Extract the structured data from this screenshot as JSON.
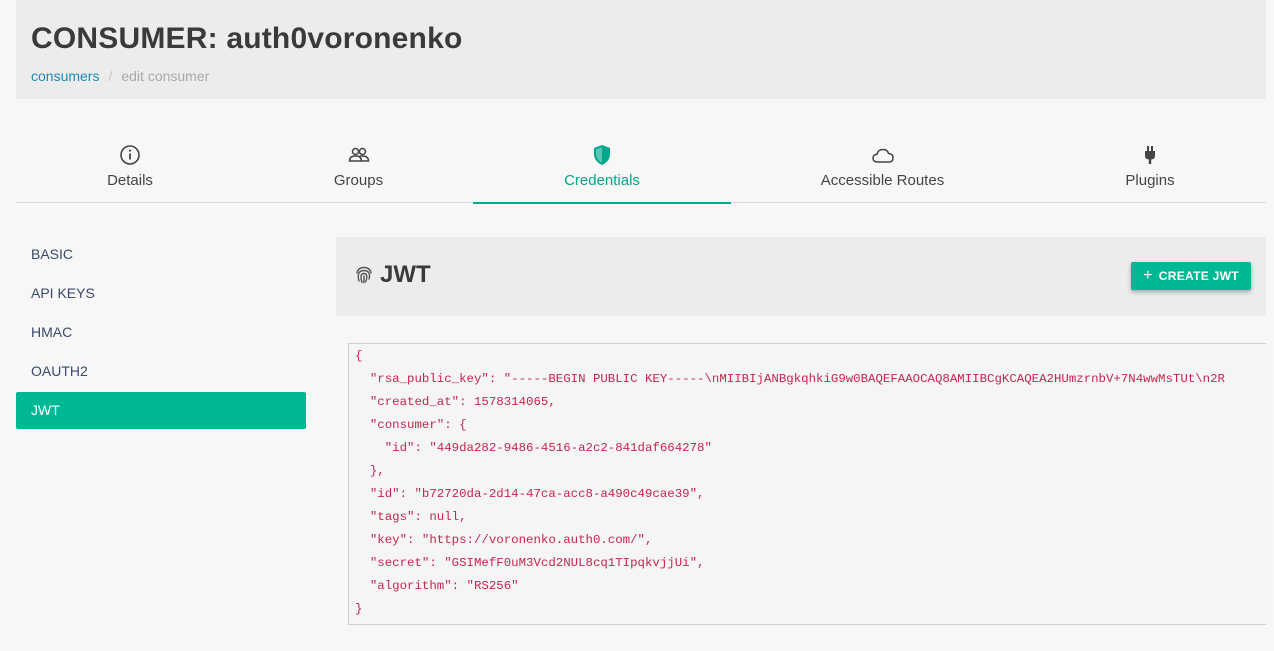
{
  "header": {
    "title": "CONSUMER: auth0voronenko",
    "breadcrumb": {
      "link": "consumers",
      "separator": "/",
      "current": "edit consumer"
    }
  },
  "tabs": [
    {
      "label": "Details",
      "icon": "info-icon"
    },
    {
      "label": "Groups",
      "icon": "users-icon"
    },
    {
      "label": "Credentials",
      "icon": "shield-icon",
      "active": true
    },
    {
      "label": "Accessible Routes",
      "icon": "cloud-icon"
    },
    {
      "label": "Plugins",
      "icon": "plug-icon"
    }
  ],
  "sidebar": {
    "items": [
      {
        "label": "BASIC"
      },
      {
        "label": "API KEYS"
      },
      {
        "label": "HMAC"
      },
      {
        "label": "OAUTH2"
      },
      {
        "label": "JWT",
        "active": true
      }
    ]
  },
  "panel": {
    "title": "JWT",
    "icon": "fingerprint-icon",
    "create_button": "CREATE JWT"
  },
  "json_lines": [
    "{",
    "  \"rsa_public_key\": \"-----BEGIN PUBLIC KEY-----\\nMIIBIjANBgkqhkiG9w0BAQEFAAOCAQ8AMIIBCgKCAQEA2HUmzrnbV+7N4wwMsTUt\\n2R",
    "  \"created_at\": 1578314065,",
    "  \"consumer\": {",
    "    \"id\": \"449da282-9486-4516-a2c2-841daf664278\"",
    "  },",
    "  \"id\": \"b72720da-2d14-47ca-acc8-a490c49cae39\",",
    "  \"tags\": null,",
    "  \"key\": \"https://voronenko.auth0.com/\",",
    "  \"secret\": \"GSIMefF0uM3Vcd2NUL8cq1TIpqkvjjUi\",",
    "  \"algorithm\": \"RS256\"",
    "}"
  ],
  "colors": {
    "accent": "#00b894",
    "active_tab": "#00a88c",
    "link": "#1e88b4",
    "code_text": "#c7254e"
  }
}
